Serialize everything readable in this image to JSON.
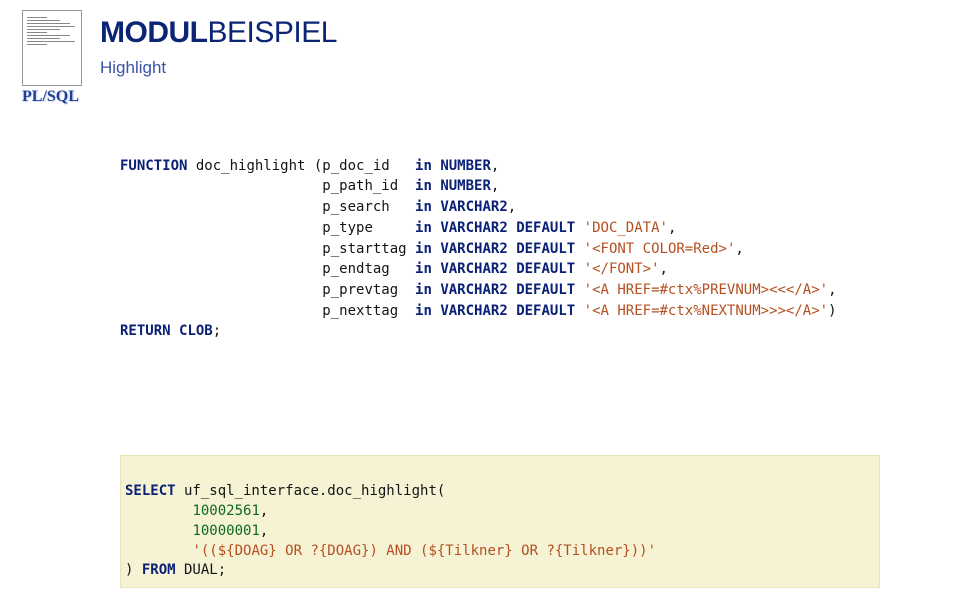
{
  "badge": {
    "plsql": "PL/SQL"
  },
  "title": {
    "bold": "MODUL",
    "light": "BEISPIEL"
  },
  "subtitle": "Highlight",
  "codeA": {
    "fn_kw": "FUNCTION",
    "fn_name": " doc_highlight (",
    "p0_name": "p_doc_id",
    "p0_ty": "NUMBER",
    "p0_tail": ",",
    "p1_name": "p_path_id",
    "p1_ty": "NUMBER",
    "p1_tail": ",",
    "p2_name": "p_search",
    "p2_ty": "VARCHAR2",
    "p2_tail": ",",
    "p3_name": "p_type",
    "p3_ty": "VARCHAR2",
    "p3_def": "'DOC_DATA'",
    "p3_tail": ",",
    "p4_name": "p_starttag",
    "p4_ty": "VARCHAR2",
    "p4_def": "'<FONT COLOR=Red>'",
    "p4_tail": ",",
    "p5_name": "p_endtag",
    "p5_ty": "VARCHAR2",
    "p5_def": "'</FONT>'",
    "p5_tail": ",",
    "p6_name": "p_prevtag",
    "p6_ty": "VARCHAR2",
    "p6_def": "'<A HREF=#ctx%PREVNUM><<</A>'",
    "p6_tail": ",",
    "p7_name": "p_nexttag",
    "p7_ty": "VARCHAR2",
    "p7_def": "'<A HREF=#ctx%NEXTNUM>>></A>'",
    "p7_tail": ")",
    "in_kw": "in",
    "def_kw": "DEFAULT",
    "ret": "RETURN",
    "ret_ty": "CLOB",
    "semi": ";"
  },
  "codeB": {
    "kw_select": "SELECT",
    "call": " uf_sql_interface.doc_highlight(",
    "arg0": "10002561",
    "arg1": "10000001",
    "arg2": "'((${DOAG} OR ?{DOAG}) AND (${Tilkner} OR ?{Tilkner}))'",
    "comma": ",",
    "close": ") ",
    "kw_from": "FROM",
    "dual": " DUAL;"
  }
}
